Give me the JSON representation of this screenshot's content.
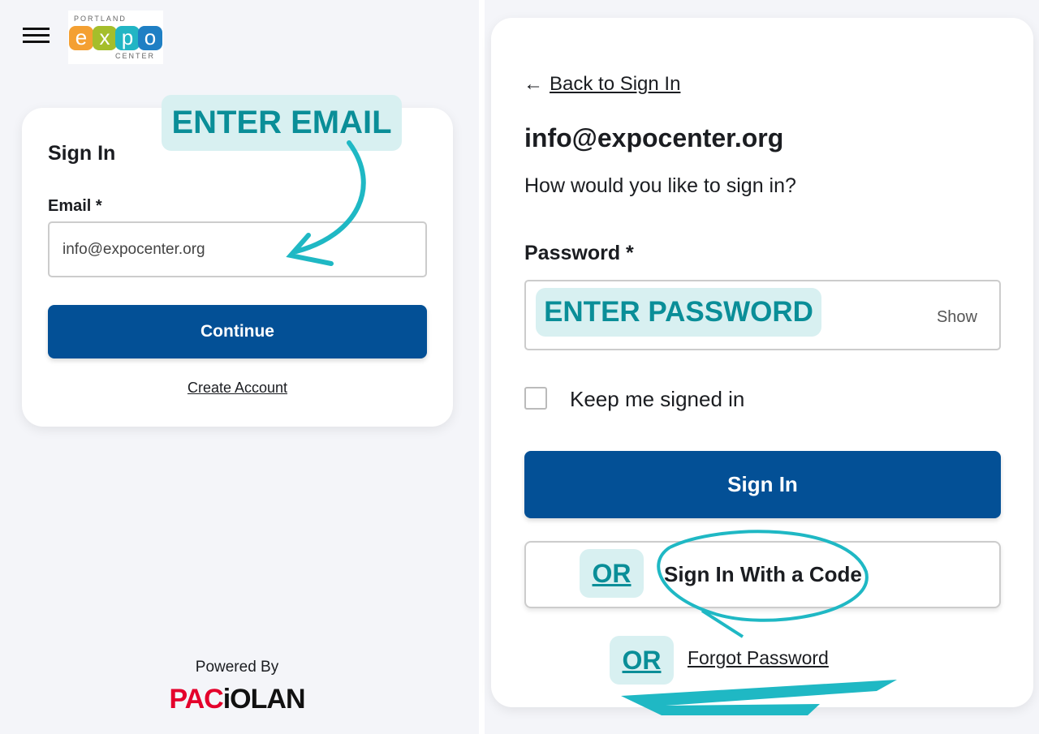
{
  "header": {
    "logo_text": {
      "top": "PORTLAND",
      "letters": [
        "e",
        "x",
        "p",
        "o"
      ],
      "bottom": "CENTER"
    }
  },
  "email_step": {
    "title": "Sign In",
    "email_label": "Email *",
    "email_value": "info@expocenter.org",
    "continue": "Continue",
    "create_account": "Create Account"
  },
  "footer": {
    "powered_by": "Powered By",
    "brand_red": "PAC",
    "brand_black": "iOLAN"
  },
  "password_step": {
    "back": "Back to Sign In",
    "email": "info@expocenter.org",
    "question": "How would you like to sign in?",
    "password_label": "Password *",
    "show": "Show",
    "keep_signed_in": "Keep me signed in",
    "keep_signed_in_checked": false,
    "sign_in": "Sign In",
    "sign_in_code": "Sign In With a Code",
    "forgot": "Forgot Password"
  },
  "annotations": {
    "enter_email": "ENTER EMAIL",
    "enter_password": "ENTER PASSWORD",
    "or1": "OR",
    "or2": "OR"
  },
  "colors": {
    "primary": "#035096",
    "annotation": "#1fb8c4",
    "annotation_bg": "#d8f0f1",
    "brand_red": "#e4002b"
  }
}
